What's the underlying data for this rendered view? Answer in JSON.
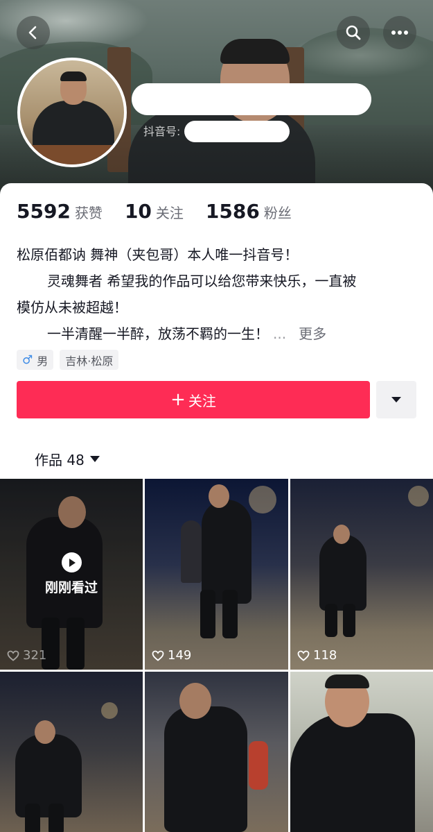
{
  "header": {
    "id_label": "抖音号:",
    "buttons": {
      "back": "back-icon",
      "search": "search-icon",
      "more": "more-icon"
    }
  },
  "stats": {
    "likes_count": "5592",
    "likes_label": "获赞",
    "following_count": "10",
    "following_label": "关注",
    "followers_count": "1586",
    "followers_label": "粉丝"
  },
  "bio": {
    "line1": "松原佰都讷 舞神（夹包哥）本人唯一抖音号！",
    "line2": "灵魂舞者 希望我的作品可以给您带来快乐，一直被",
    "line3": "模仿从未被超越！",
    "line4": "一半清醒一半醉，放荡不羁的一生！",
    "ellipsis": "...",
    "more": "更多"
  },
  "tags": {
    "gender_symbol": "♂",
    "gender": "男",
    "location": "吉林·松原"
  },
  "actions": {
    "follow_plus": "+",
    "follow_label": "关注"
  },
  "works": {
    "label": "作品 48"
  },
  "videos": [
    {
      "likes": "321",
      "watched_label": "刚刚看过"
    },
    {
      "likes": "149"
    },
    {
      "likes": "118"
    },
    {
      "likes": ""
    },
    {
      "likes": ""
    },
    {
      "likes": ""
    }
  ],
  "colors": {
    "accent": "#fe2c55",
    "gender_blue": "#3d8be6"
  }
}
